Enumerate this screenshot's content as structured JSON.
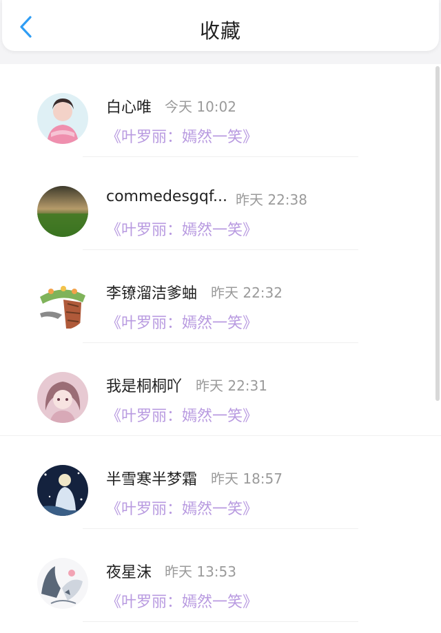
{
  "header": {
    "title": "收藏",
    "back_icon": "chevron-left-icon",
    "accent_color": "#2f9df4"
  },
  "favorites": [
    {
      "name": "白心唯",
      "time": "今天 10:02",
      "book": "《叶罗丽：嫣然一笑》"
    },
    {
      "name": "commedesgqf...",
      "time": "昨天 22:38",
      "book": "《叶罗丽：嫣然一笑》"
    },
    {
      "name": "李镣溜洁爹蚰",
      "time": "昨天 22:32",
      "book": "《叶罗丽：嫣然一笑》"
    },
    {
      "name": "我是桐桐吖",
      "time": "昨天 22:31",
      "book": "《叶罗丽：嫣然一笑》"
    },
    {
      "name": "半雪寒半梦霜",
      "time": "昨天 18:57",
      "book": "《叶罗丽：嫣然一笑》"
    },
    {
      "name": "夜星沫",
      "time": "昨天 13:53",
      "book": "《叶罗丽：嫣然一笑》"
    }
  ],
  "colors": {
    "book_title": "#b89ae0",
    "timestamp": "#9a9a9a",
    "name": "#222222"
  }
}
